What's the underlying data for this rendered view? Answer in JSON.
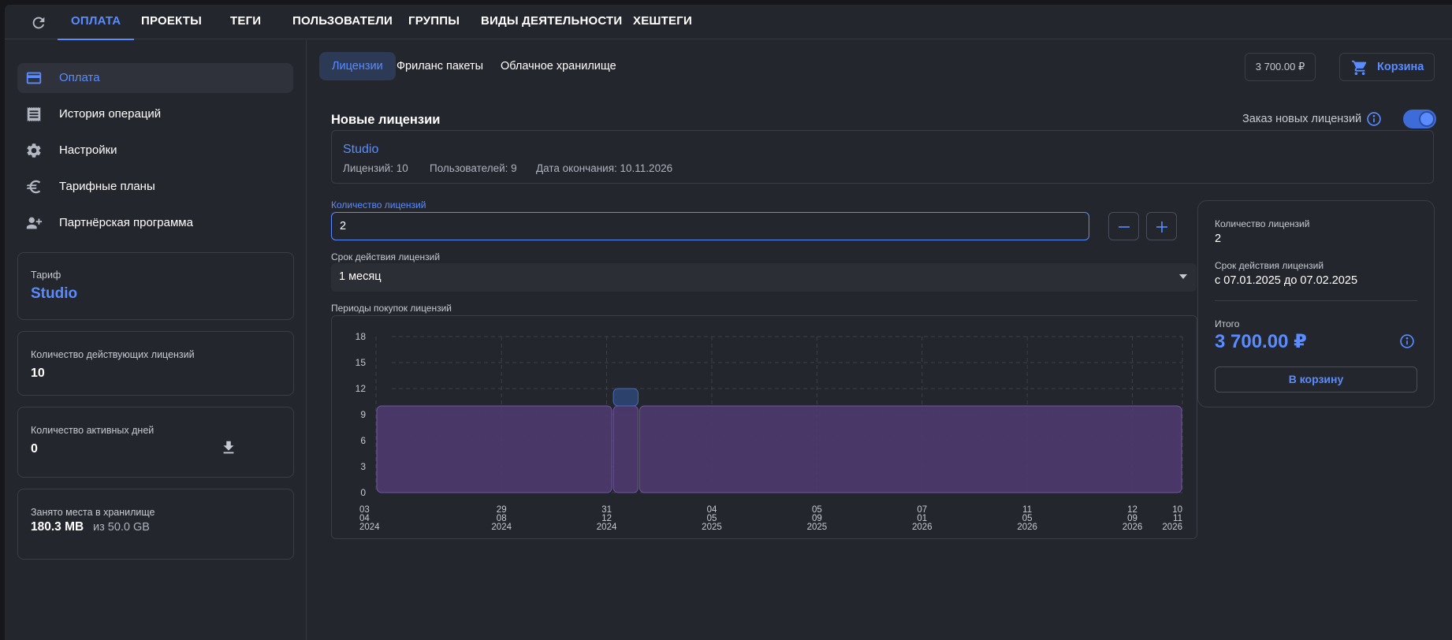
{
  "nav": {
    "refresh_icon": "refresh-icon",
    "tabs": [
      {
        "label": "ОПЛАТА",
        "active": true
      },
      {
        "label": "ПРОЕКТЫ",
        "active": false
      },
      {
        "label": "ТЕГИ",
        "active": false
      },
      {
        "label": "ПОЛЬЗОВАТЕЛИ",
        "active": false
      },
      {
        "label": "ГРУППЫ",
        "active": false
      },
      {
        "label": "ВИДЫ ДЕЯТЕЛЬНОСТИ",
        "active": false
      },
      {
        "label": "ХЕШТЕГИ",
        "active": false
      }
    ]
  },
  "sidebar": {
    "items": [
      {
        "label": "Оплата",
        "icon": "credit-card-icon",
        "active": true
      },
      {
        "label": "История операций",
        "icon": "receipt-icon",
        "active": false
      },
      {
        "label": "Настройки",
        "icon": "gear-icon",
        "active": false
      },
      {
        "label": "Тарифные планы",
        "icon": "euro-icon",
        "active": false
      },
      {
        "label": "Партнёрская программа",
        "icon": "add-user-icon",
        "active": false
      }
    ],
    "tariff": {
      "caption": "Тариф",
      "value": "Studio"
    },
    "active_licenses": {
      "caption": "Количество действующих лицензий",
      "value": "10"
    },
    "active_days": {
      "caption": "Количество активных дней",
      "value": "0",
      "icon": "download-icon"
    },
    "storage": {
      "caption": "Занято места в хранилище",
      "used": "180.3 MB",
      "total": "из 50.0 GB"
    }
  },
  "main": {
    "subtabs": [
      {
        "label": "Лицензии",
        "active": true
      },
      {
        "label": "Фриланс пакеты",
        "active": false
      },
      {
        "label": "Облачное хранилище",
        "active": false
      }
    ],
    "cart_total": "3 700.00 ₽",
    "cart_label": "Корзина",
    "section_title": "Новые лицензии",
    "order_toggle_label": "Заказ новых лицензий",
    "order_toggle_on": true,
    "plan": {
      "name": "Studio",
      "licenses": "Лицензий: 10",
      "users": "Пользователей: 9",
      "end_date": "Дата окончания: 10.11.2026"
    },
    "qty_label": "Количество лицензий",
    "qty_value": "2",
    "period_label": "Срок действия лицензий",
    "period_value": "1 месяц",
    "chart_label": "Периоды покупок лицензий"
  },
  "summary": {
    "qty_caption": "Количество лицензий",
    "qty_value": "2",
    "period_caption": "Срок действия лицензий",
    "period_value": "с 07.01.2025 до 07.02.2025",
    "total_caption": "Итого",
    "total_value": "3 700.00 ₽",
    "button_label": "В корзину"
  },
  "colors": {
    "accent": "#5a8cff",
    "existing_period": "#4e3a6e",
    "new_period": "#2d4270"
  },
  "chart_data": {
    "type": "bar",
    "title": "Периоды покупок лицензий",
    "ylim": [
      0,
      18
    ],
    "yticks": [
      "0",
      "3",
      "6",
      "9",
      "12",
      "15",
      "18"
    ],
    "xticks": [
      {
        "date": "2024-04-03",
        "label": [
          "03",
          "04",
          "2024"
        ]
      },
      {
        "date": "2024-08-29",
        "label": [
          "29",
          "08",
          "2024"
        ]
      },
      {
        "date": "2024-12-31",
        "label": [
          "31",
          "12",
          "2024"
        ]
      },
      {
        "date": "2025-05-04",
        "label": [
          "04",
          "05",
          "2025"
        ]
      },
      {
        "date": "2025-09-05",
        "label": [
          "05",
          "09",
          "2025"
        ]
      },
      {
        "date": "2026-01-07",
        "label": [
          "07",
          "01",
          "2026"
        ]
      },
      {
        "date": "2026-05-11",
        "label": [
          "11",
          "05",
          "2026"
        ]
      },
      {
        "date": "2026-09-12",
        "label": [
          "12",
          "09",
          "2026"
        ]
      },
      {
        "date": "2026-11-10",
        "label": [
          "10",
          "11",
          "2026"
        ]
      }
    ],
    "segments": [
      {
        "start": "2024-04-03",
        "end": "2025-01-07",
        "value": 10,
        "kind": "existing"
      },
      {
        "start": "2025-01-07",
        "end": "2025-02-07",
        "value": 10,
        "kind": "existing"
      },
      {
        "start": "2025-01-07",
        "end": "2025-02-07",
        "value": 2,
        "base": 10,
        "kind": "new"
      },
      {
        "start": "2025-02-07",
        "end": "2026-11-10",
        "value": 10,
        "kind": "existing"
      }
    ],
    "grid": true
  }
}
